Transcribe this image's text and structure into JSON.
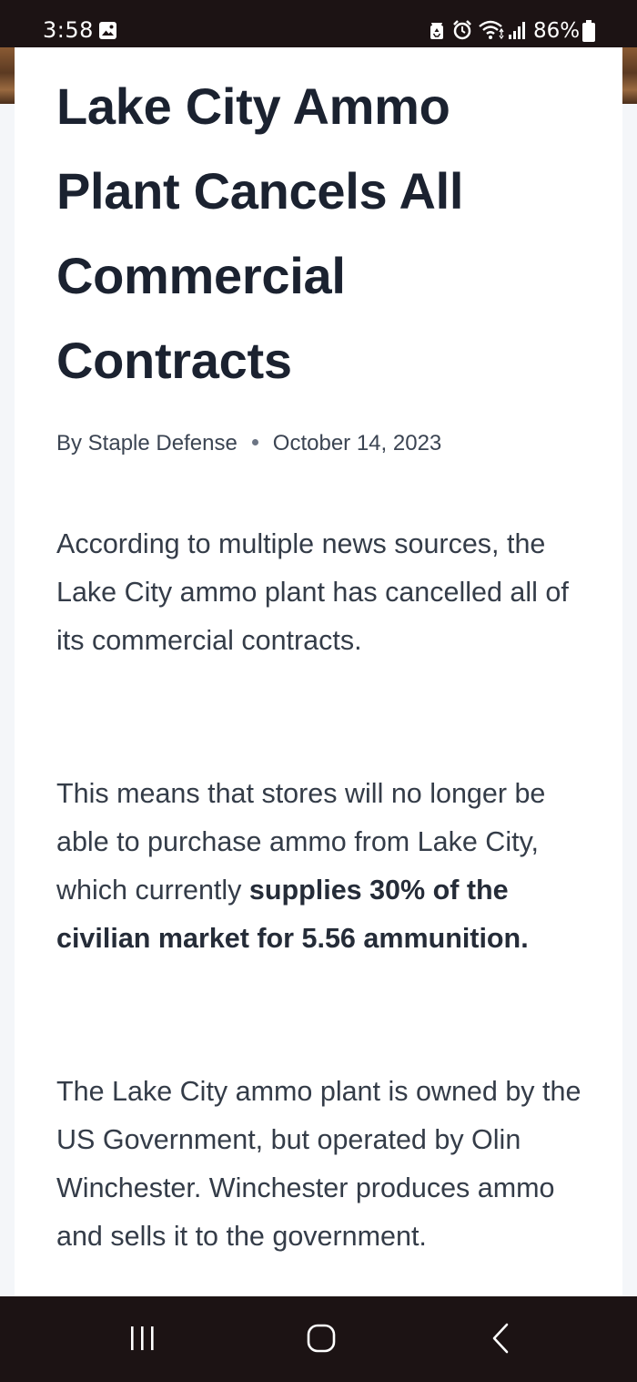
{
  "status_bar": {
    "time": "3:58",
    "battery_percent": "86%",
    "icons": [
      "image-notification-icon",
      "recycle-icon",
      "alarm-icon",
      "wifi-icon",
      "signal-icon",
      "battery-icon"
    ]
  },
  "article": {
    "title": "Lake City Ammo Plant Cancels All Commercial Contracts",
    "author": "By Staple Defense",
    "date": "October 14, 2023",
    "paragraphs": {
      "p1": "According to multiple news sources, the Lake City ammo plant has cancelled all of its commercial contracts.",
      "p2_start": "This means that stores will no longer be able to purchase ammo from Lake City, which currently ",
      "p2_bold": "supplies 30% of the civilian market for 5.56 ammunition.",
      "p3": "The Lake City ammo plant is owned by the US Government, but operated by Olin Winchester. Winchester produces ammo and sells it to the government."
    }
  },
  "nav_bar": {
    "buttons": [
      "recent-apps-icon",
      "home-icon",
      "back-icon"
    ]
  }
}
